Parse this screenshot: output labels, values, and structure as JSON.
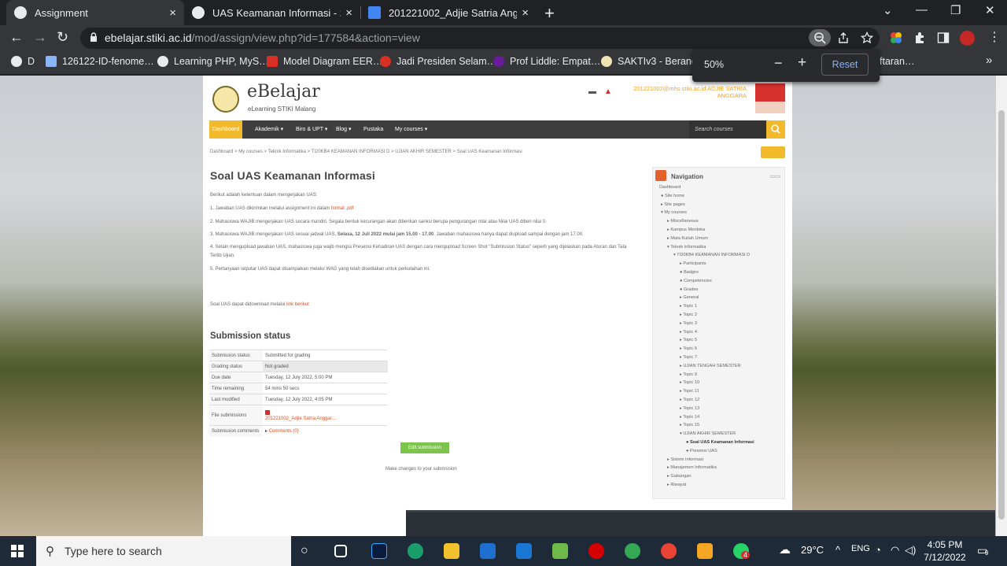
{
  "browser": {
    "tabs": [
      {
        "title": "Assignment",
        "close": "×",
        "favicon_color": "#e8eaed"
      },
      {
        "title": "UAS Keamanan Informasi - 2022…",
        "close": "×",
        "favicon_color": "#e8eaed"
      },
      {
        "title": "201221002_Adjie Satria Anggara…",
        "close": "×",
        "favicon_color": "#4285f4"
      }
    ],
    "new_tab": "+",
    "window_controls": [
      "⌄",
      "—",
      "❐",
      "✕"
    ],
    "url_host": "ebelajar.stiki.ac.id",
    "url_path": "/mod/assign/view.php?id=177584&action=view",
    "nav": {
      "back": "←",
      "forward": "→",
      "reload": "↻"
    },
    "bookmarks": [
      {
        "label": "D",
        "color": "#e8eaed"
      },
      {
        "label": "126122-ID-fenome…",
        "color": "#8ab4f8"
      },
      {
        "label": "Learning PHP, MyS…",
        "color": "#e8eaed"
      },
      {
        "label": "Model Diagram EER…",
        "color": "#d93025"
      },
      {
        "label": "Jadi Presiden Selam…",
        "color": "#d93025"
      },
      {
        "label": "Prof Liddle: Empat…",
        "color": "#6a1b9a"
      },
      {
        "label": "SAKTIv3 - Beranda",
        "color": "#f1e4b3"
      },
      {
        "label": "ftaran…",
        "color": "#35363a"
      }
    ],
    "bookmarks_more": "»",
    "zoom": {
      "level": "50%",
      "minus": "−",
      "plus": "+",
      "reset": "Reset"
    }
  },
  "site": {
    "brand": "eBelajar",
    "brand_sub": "eLearning STIKI Malang",
    "user_line1": "201221002@mhs.stiki.ac.id ADJIE SATRIA",
    "user_line2": "ANGGARA",
    "menu": [
      "Dashboard",
      "Akademik ▾",
      "Biro & UPT ▾",
      "Blog ▾",
      "Pustaka",
      "My courses ▾"
    ],
    "search_placeholder": "Search courses",
    "breadcrumb": "Dashboard  >  My courses  >  Teknik Informatika  >  TI20KB4 KEAMANAN INFORMASI D  >  UJIAN AKHIR SEMESTER  >  Soal UAS Keamanan Informasi"
  },
  "assignment": {
    "title": "Soal UAS Keamanan Informasi",
    "intro": "Berikut adalah ketentuan dalam mengerjakan UAS:",
    "rules": [
      {
        "pre": "1.    Jawaban UAS dikirimkan melalui assignment ini dalam ",
        "link": "format .pdf",
        "post": ""
      },
      {
        "pre": "2.    Mahasiswa WAJIB mengerjakan UAS secara mandiri. Segala bentuk kecurangan akan diberikan sanksi berupa pengurangan nilai atau Nilai UAS diberi nilai 0.",
        "link": "",
        "post": ""
      },
      {
        "pre": "3.    Mahasiswa WAJIB mengerjakan UAS sesuai jadwal UAS, ",
        "bold": "Selasa, 12 Juli 2022 mulai jam 15.00 - 17.00",
        "post": ". Jawaban mahasiswa hanya dapat diupload sampai dengan jam 17.00."
      },
      {
        "pre": "4.    Selain mengupload jawaban UAS, mahasiswa juga wajib mengisi Presensi Kehadiran UAS dengan cara mengupload Screen Shot \"Submission Status\" seperti yang dijelaskan pada Aturan dan Tata Tertib Ujian.",
        "link": "",
        "post": ""
      },
      {
        "pre": "5.    Pertanyaan seputar UAS dapat disampaikan melalui WAG yang telah disediakan untuk perkuliahan ini.",
        "link": "",
        "post": ""
      }
    ],
    "download_text": "Soal UAS dapat didownload melalui ",
    "download_link": "link berikut"
  },
  "submission": {
    "heading": "Submission status",
    "rows": [
      {
        "k": "Submission status",
        "v": "Submitted for grading"
      },
      {
        "k": "Grading status",
        "v": "Not graded"
      },
      {
        "k": "Due date",
        "v": "Tuesday, 12 July 2022, 5:00 PM"
      },
      {
        "k": "Time remaining",
        "v": "54 mins 50 secs"
      },
      {
        "k": "Last modified",
        "v": "Tuesday, 12 July 2022, 4:05 PM"
      }
    ],
    "file_label": "File submissions",
    "file_name": "201221002_Adjie Satria Anggar…",
    "comments_label": "Submission comments",
    "comments_link": "Comments (0)",
    "edit_button": "Edit submission",
    "make_changes": "Make changes to your submission"
  },
  "navigation": {
    "title": "Navigation",
    "controls": "▭▭",
    "items": [
      "Dashboard",
      "Site home",
      "Site pages",
      "My courses",
      "Miscellaneous",
      "Kampus Merdeka",
      "Mata Kuliah Umum",
      "Teknik Informatika",
      "TI20KB4 KEAMANAN INFORMASI D",
      "Participants",
      "Badges",
      "Competencies",
      "Grades",
      "General",
      "Topic 1",
      "Topic 2",
      "Topic 3",
      "Topic 4",
      "Topic 5",
      "Topic 6",
      "Topic 7",
      "UJIAN TENGAH SEMESTER",
      "Topic 9",
      "Topic 10",
      "Topic 11",
      "Topic 12",
      "Topic 13",
      "Topic 14",
      "Topic 15",
      "UJIAN AKHIR SEMESTER",
      "Soal UAS Keamanan Informasi",
      "Presensi UAS",
      "Sistem Informasi",
      "Manajemen Informatika",
      "Gabungan",
      "Riwayat"
    ]
  },
  "taskbar": {
    "search_placeholder": "Type here to search",
    "weather": "29°C",
    "time": "4:05 PM",
    "date": "7/12/2022",
    "notif_count": "9",
    "whatsapp_badge": "4",
    "lang": "ENG"
  },
  "colors": {
    "accent": "#f3b92c",
    "link": "#e24c1c",
    "button_green": "#7cc44c",
    "nav_header": "#e2612c"
  }
}
